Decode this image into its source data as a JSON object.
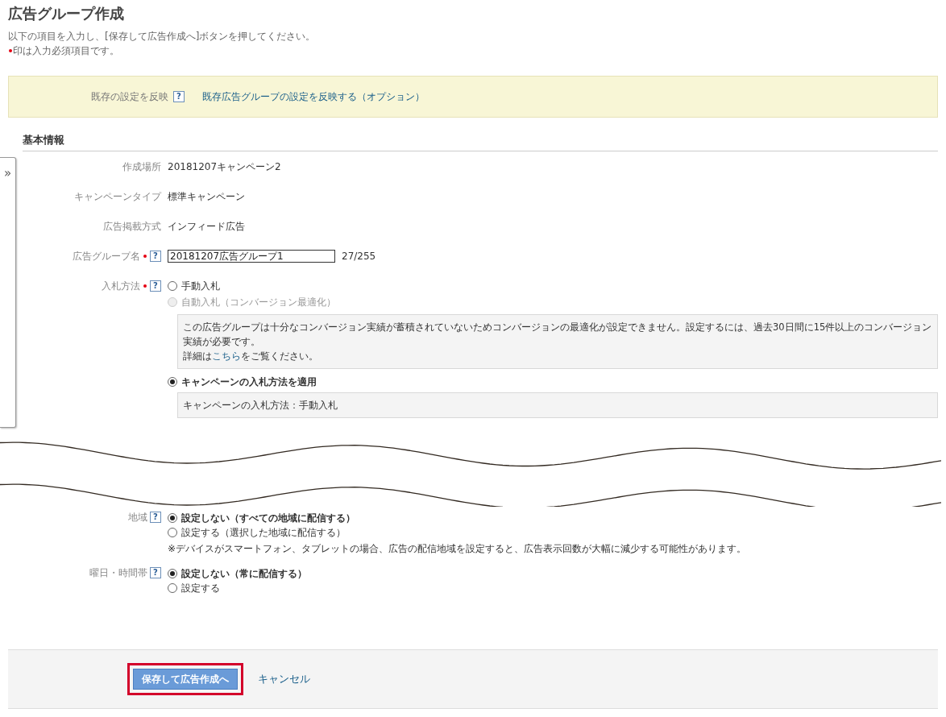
{
  "page": {
    "title": "広告グループ作成",
    "instruction": "以下の項目を入力し、[保存して広告作成へ]ボタンを押してください。",
    "required_note": {
      "text": "印は入力必須項目です。",
      "required": true
    }
  },
  "side_toggle": {
    "label": "»"
  },
  "copy_banner": {
    "label": "既存の設定を反映",
    "help": "?",
    "link": "既存広告グループの設定を反映する（オプション）"
  },
  "section": {
    "title": "基本情報"
  },
  "fields_top": [
    {
      "kind": "text",
      "label": "作成場所",
      "value": "20181207キャンペーン2"
    },
    {
      "kind": "text",
      "label": "キャンペーンタイプ",
      "value": "標準キャンペーン"
    },
    {
      "kind": "text",
      "label": "広告掲載方式",
      "value": "インフィード広告"
    },
    {
      "kind": "input",
      "label": "広告グループ名",
      "required": true,
      "help": "?",
      "value": "20181207広告グループ1",
      "counter": "27/255"
    },
    {
      "kind": "radio",
      "label": "入札方法",
      "required": true,
      "help": "?",
      "options": [
        {
          "label": "手動入札",
          "selected": false,
          "disabled": false
        },
        {
          "label": "自動入札（コンバージョン最適化）",
          "selected": false,
          "disabled": true,
          "note": {
            "text": "この広告グループは十分なコンバージョン実績が蓄積されていないためコンバージョンの最適化が設定できません。設定するには、過去30日間に15件以上のコンバージョン実績が必要です。",
            "detail_before": "詳細は",
            "link": "こちら",
            "detail_after": "をご覧ください。"
          }
        },
        {
          "label": "キャンペーンの入札方法を適用",
          "selected": true,
          "disabled": false,
          "note": {
            "text": "キャンペーンの入札方法：手動入札"
          }
        }
      ]
    }
  ],
  "fields_bottom": [
    {
      "kind": "radio",
      "label": "地域",
      "required": false,
      "help": "?",
      "options": [
        {
          "label": "設定しない（すべての地域に配信する）",
          "selected": true,
          "disabled": false
        },
        {
          "label": "設定する（選択した地域に配信する）",
          "selected": false,
          "disabled": false
        }
      ],
      "hint": "※デバイスがスマートフォン、タブレットの場合、広告の配信地域を設定すると、広告表示回数が大幅に減少する可能性があります。"
    },
    {
      "kind": "radio",
      "label": "曜日・時間帯",
      "required": false,
      "help": "?",
      "options": [
        {
          "label": "設定しない（常に配信する）",
          "selected": true,
          "disabled": false
        },
        {
          "label": "設定する",
          "selected": false,
          "disabled": false
        }
      ]
    }
  ],
  "footer": {
    "save": "保存して広告作成へ",
    "save_highlighted": true,
    "cancel": "キャンセル"
  }
}
